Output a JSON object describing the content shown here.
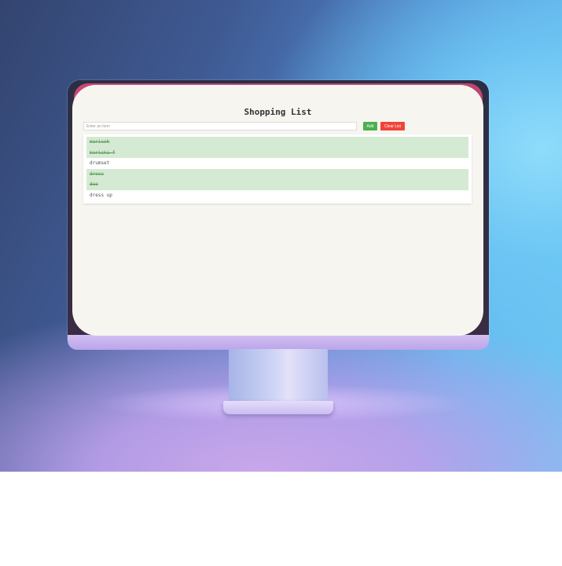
{
  "app": {
    "title": "Shopping List",
    "input_placeholder": "Enter an item",
    "input_value": "",
    "add_label": "Add",
    "clear_label": "Clear List"
  },
  "items": [
    {
      "text": "mariseh",
      "completed": true
    },
    {
      "text": "mariska f",
      "completed": true
    },
    {
      "text": "drumset",
      "completed": false
    },
    {
      "text": "dress",
      "completed": true
    },
    {
      "text": "duo",
      "completed": true
    },
    {
      "text": "dress up",
      "completed": false
    }
  ],
  "colors": {
    "add_button": "#4caf50",
    "clear_button": "#f0443a",
    "completed_row": "#d5ead2",
    "screen_background": "#f7f5f0"
  }
}
